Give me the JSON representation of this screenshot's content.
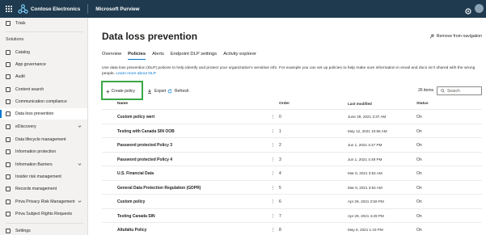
{
  "topbar": {
    "org_name": "Contoso Electronics",
    "app_name": "Microsoft Purview"
  },
  "sidebar": {
    "trials": "Trials",
    "solutions_heading": "Solutions",
    "items": [
      {
        "label": "Catalog"
      },
      {
        "label": "App governance"
      },
      {
        "label": "Audit"
      },
      {
        "label": "Content search"
      },
      {
        "label": "Communication compliance"
      },
      {
        "label": "Data loss prevention"
      },
      {
        "label": "eDiscovery"
      },
      {
        "label": "Data lifecycle management"
      },
      {
        "label": "Information protection"
      },
      {
        "label": "Information Barriers"
      },
      {
        "label": "Insider risk management"
      },
      {
        "label": "Records management"
      },
      {
        "label": "Priva Privacy Risk Management"
      },
      {
        "label": "Priva Subject Rights Requests"
      }
    ],
    "settings": "Settings"
  },
  "main": {
    "title": "Data loss prevention",
    "remove_nav": "Remove from navigation",
    "tabs": [
      "Overview",
      "Policies",
      "Alerts",
      "Endpoint DLP settings",
      "Activity explorer"
    ],
    "description": "Use data loss prevention (DLP) policies to help identify and protect your organization's sensitive info. For example you can set up policies to help make sure information in email and docs isn't shared with the wrong people.",
    "learn_more": "Learn more about DLP",
    "create_policy": "Create policy",
    "export": "Export",
    "refresh": "Refresh",
    "items_count": "26 items",
    "search_placeholder": "Search",
    "columns": {
      "name": "Name",
      "order": "Order",
      "modified": "Last modified",
      "status": "Status"
    },
    "rows": [
      {
        "name": "Custom policy wert",
        "order": "0",
        "modified": "June 29, 2021 3:37 AM",
        "status": "On"
      },
      {
        "name": "Testing with Canada SIN OOB",
        "order": "1",
        "modified": "May 12, 2021 10:56 AM",
        "status": "On"
      },
      {
        "name": "Password protected Policy 3",
        "order": "2",
        "modified": "Jun 1, 2021 4:47 PM",
        "status": "On"
      },
      {
        "name": "Password protected Policy 4",
        "order": "3",
        "modified": "Jun 1, 2021 4:49 PM",
        "status": "On"
      },
      {
        "name": "U.S. Financial Data",
        "order": "4",
        "modified": "Mar 6, 2021 3:54 AM",
        "status": "On"
      },
      {
        "name": "General Data Protection Regulation (GDPR)",
        "order": "5",
        "modified": "Mar 6, 2021 3:54 AM",
        "status": "On"
      },
      {
        "name": "Custom policy",
        "order": "6",
        "modified": "Apr 29, 2021 2:59 PM",
        "status": "On"
      },
      {
        "name": "Testing Canada SIN",
        "order": "7",
        "modified": "Apr 29, 2021 4:29 PM",
        "status": "On"
      },
      {
        "name": "Altufaltu Policy",
        "order": "8",
        "modified": "May 6, 2021 1:43 PM",
        "status": "On"
      }
    ]
  },
  "colors": {
    "topbar": "#1f3a4e",
    "accent": "#0078d4",
    "highlight": "#3aa845"
  }
}
